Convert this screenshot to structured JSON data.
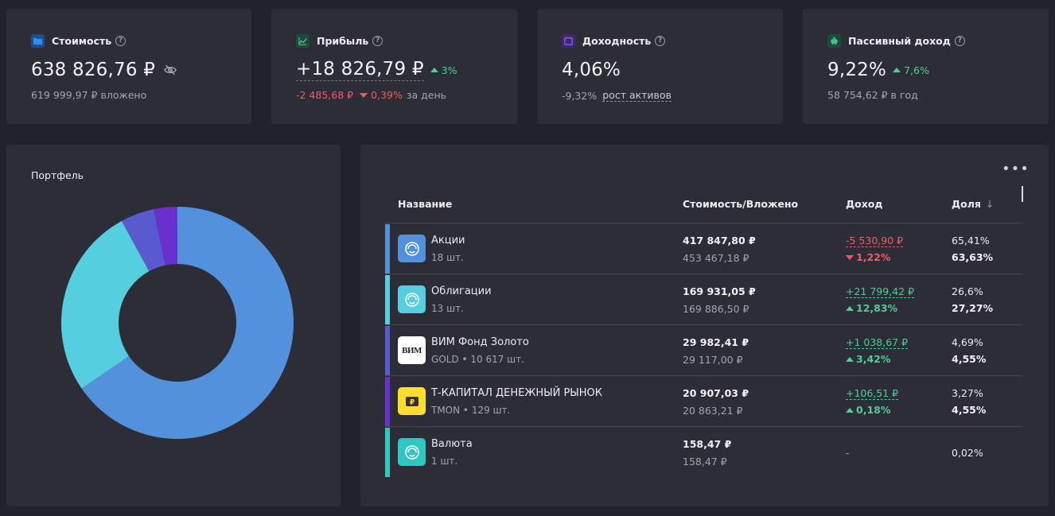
{
  "stats": {
    "cost": {
      "label": "Стоимость",
      "value": "638 826,76 ₽",
      "sub": "619 999,97 ₽ вложено",
      "icon": "folder-icon",
      "color": "#2f8ff0"
    },
    "profit": {
      "label": "Прибыль",
      "value": "+18 826,79 ₽",
      "delta": "3%",
      "day_value": "-2 485,68 ₽",
      "day_pct": "0,39%",
      "day_label": "за день",
      "icon": "chart-icon",
      "color": "#3ec28a"
    },
    "yield": {
      "label": "Доходность",
      "value": "4,06%",
      "sub_value": "-9,32%",
      "sub_label": "рост активов",
      "icon": "calendar-icon",
      "color": "#8b5cf6"
    },
    "passive": {
      "label": "Пассивный доход",
      "value": "9,22%",
      "delta": "7,6%",
      "sub": "58 754,62 ₽ в год",
      "icon": "piggy-bank-icon",
      "color": "#3ec28a"
    }
  },
  "portfolio": {
    "title": "Портфель"
  },
  "table": {
    "headers": {
      "name": "Название",
      "cost": "Стоимость/Вложено",
      "income": "Доход",
      "share": "Доля"
    },
    "rows": [
      {
        "name": "Акции",
        "qty": "18 шт.",
        "cost": "417 847,80 ₽",
        "invested": "453 467,18 ₽",
        "income": "-5 530,90 ₽",
        "income_pct": "1,22%",
        "income_dir": "down",
        "share": "65,41%",
        "share2": "63,63%",
        "color": "#5291dc",
        "logo": "stocks-icon"
      },
      {
        "name": "Облигации",
        "qty": "13 шт.",
        "cost": "169 931,05 ₽",
        "invested": "169 886,50 ₽",
        "income": "+21 799,42 ₽",
        "income_pct": "12,83%",
        "income_dir": "up",
        "share": "26,6%",
        "share2": "27,27%",
        "color": "#55cfe0",
        "logo": "bonds-icon"
      },
      {
        "name": "ВИМ Фонд Золото",
        "qty": "GOLD • 10 617 шт.",
        "cost": "29 982,41 ₽",
        "invested": "29 117,00 ₽",
        "income": "+1 038,67 ₽",
        "income_pct": "3,42%",
        "income_dir": "up",
        "share": "4,69%",
        "share2": "4,55%",
        "color": "#5a5acf",
        "logo": "vim-logo",
        "logo_text": "ВИМ"
      },
      {
        "name": "Т-КАПИТАЛ ДЕНЕЖНЫЙ РЫНОК",
        "qty": "TMON • 129 шт.",
        "cost": "20 907,03 ₽",
        "invested": "20 863,21 ₽",
        "income": "+106,51 ₽",
        "income_pct": "0,18%",
        "income_dir": "up",
        "share": "3,27%",
        "share2": "4,55%",
        "color": "#6a2fcf",
        "logo": "t-capital-logo"
      },
      {
        "name": "Валюта",
        "qty": "1 шт.",
        "cost": "158,47 ₽",
        "invested": "158,47 ₽",
        "income": "-",
        "share": "0,02%",
        "color": "#2ec7c2",
        "logo": "currency-icon"
      }
    ]
  }
}
